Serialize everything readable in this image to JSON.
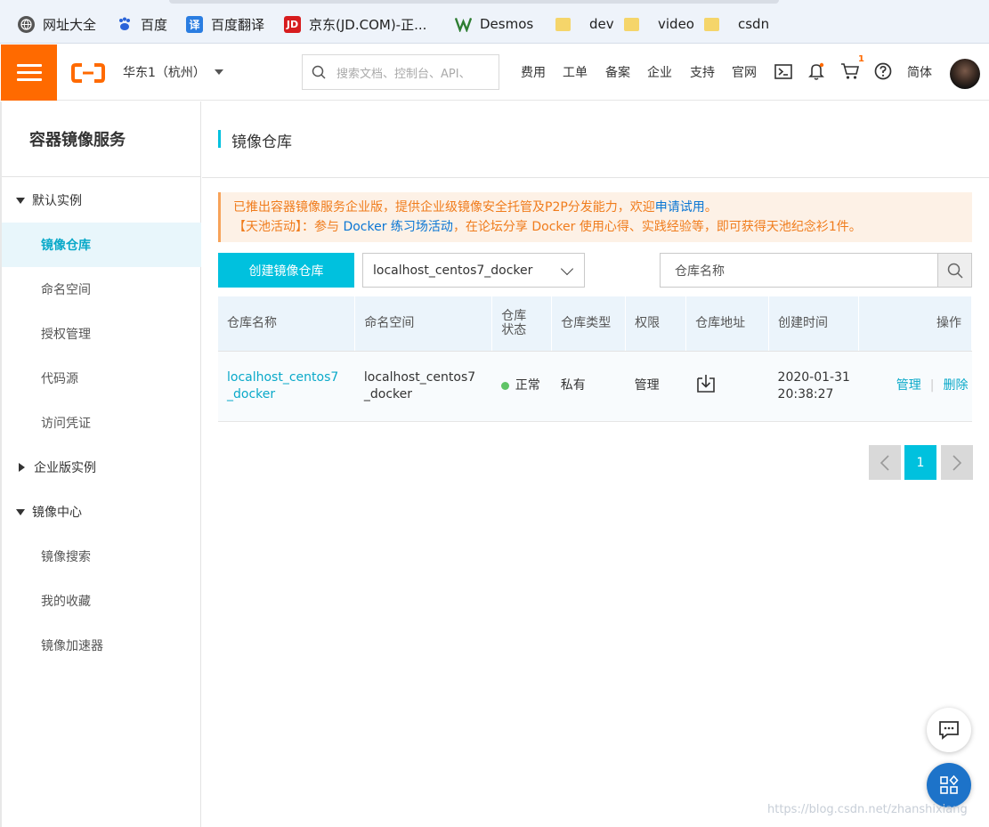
{
  "bookmarks": [
    {
      "label": "网址大全",
      "icon": "globe-icon"
    },
    {
      "label": "百度",
      "icon": "baidu-paw-icon"
    },
    {
      "label": "百度翻译",
      "icon": "translate-icon"
    },
    {
      "label": "京东(JD.COM)-正...",
      "icon": "jd-logo-icon"
    },
    {
      "label": "Desmos",
      "icon": "desmos-icon"
    },
    {
      "label": "dev",
      "icon": "folder-icon"
    },
    {
      "label": "video",
      "icon": "folder-icon"
    },
    {
      "label": "csdn",
      "icon": "folder-icon"
    }
  ],
  "topnav": {
    "region": "华东1（杭州）",
    "search_placeholder": "搜索文档、控制台、API、",
    "links": [
      "费用",
      "工单",
      "备案",
      "企业",
      "支持",
      "官网"
    ],
    "cart_badge": "1",
    "language": "简体"
  },
  "sidebar": {
    "title": "容器镜像服务",
    "group1": "默认实例",
    "group1_items": [
      "镜像仓库",
      "命名空间",
      "授权管理",
      "代码源",
      "访问凭证"
    ],
    "group2": "企业版实例",
    "group3": "镜像中心",
    "group3_items": [
      "镜像搜索",
      "我的收藏",
      "镜像加速器"
    ]
  },
  "main": {
    "title": "镜像仓库",
    "notice_line1_pre": "已推出容器镜像服务企业版，提供企业级镜像安全托管及P2P分发能力，欢迎",
    "notice_line1_link": "申请试用",
    "notice_line1_post": "。",
    "notice_line2_pre": "【天池活动】：参与 ",
    "notice_line2_link": "Docker 练习场活动",
    "notice_line2_post": "，在论坛分享 Docker 使用心得、实践经验等，即可获得天池纪念衫1件。",
    "create_button": "创建镜像仓库",
    "namespace_selected": "localhost_centos7_docker",
    "repo_search_placeholder": "仓库名称",
    "table": {
      "headers": [
        "仓库名称",
        "命名空间",
        "仓库状态",
        "仓库类型",
        "权限",
        "仓库地址",
        "创建时间",
        "操作"
      ],
      "rows": [
        {
          "name": "localhost_centos7_docker",
          "namespace": "localhost_centos7_docker",
          "status": "正常",
          "type": "私有",
          "permission": "管理",
          "created": "2020-01-31 20:38:27",
          "op_manage": "管理",
          "op_delete": "删除"
        }
      ]
    },
    "pagination_current": "1"
  },
  "watermark": "https://blog.csdn.net/zhanshixiang",
  "colors": {
    "brand_orange": "#ff6a00",
    "accent_cyan": "#00c1de",
    "link_blue": "#0aa9c9",
    "status_green": "#5fc466"
  }
}
